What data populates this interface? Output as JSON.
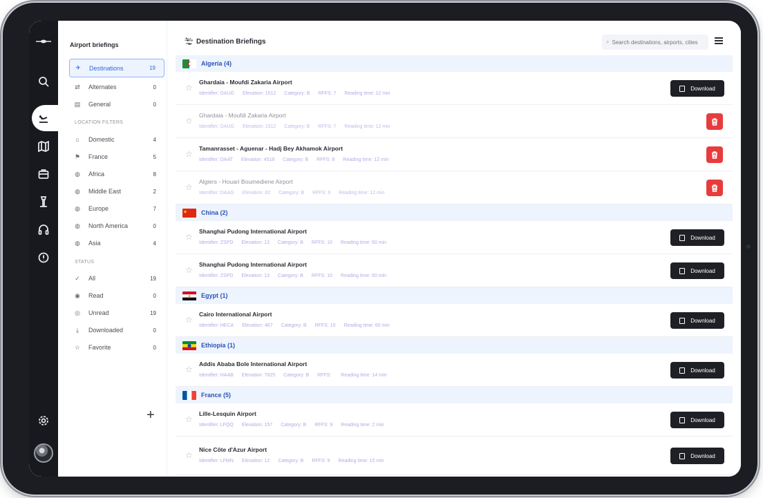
{
  "sidebar": {
    "title": "Airport briefings",
    "primary": [
      {
        "label": "Destinations",
        "count": "19",
        "icon": "plane-icon"
      },
      {
        "label": "Alternates",
        "count": "0",
        "icon": "swap-icon"
      },
      {
        "label": "General",
        "count": "0",
        "icon": "document-icon"
      }
    ],
    "location_section": "LOCATION FILTERS",
    "locations": [
      {
        "label": "Domestic",
        "count": "4",
        "icon": "home-icon"
      },
      {
        "label": "France",
        "count": "5",
        "icon": "flag-icon"
      },
      {
        "label": "Africa",
        "count": "8",
        "icon": "globe-icon"
      },
      {
        "label": "Middle East",
        "count": "2",
        "icon": "globe-icon"
      },
      {
        "label": "Europe",
        "count": "7",
        "icon": "globe-icon"
      },
      {
        "label": "North America",
        "count": "0",
        "icon": "globe-icon"
      },
      {
        "label": "Asia",
        "count": "4",
        "icon": "globe-icon"
      }
    ],
    "status_section": "STATUS",
    "status": [
      {
        "label": "All",
        "count": "19",
        "icon": "check-all-icon"
      },
      {
        "label": "Read",
        "count": "0",
        "icon": "eye-icon"
      },
      {
        "label": "Unread",
        "count": "19",
        "icon": "eye-off-icon"
      },
      {
        "label": "Downloaded",
        "count": "0",
        "icon": "download-icon"
      },
      {
        "label": "Favorite",
        "count": "0",
        "icon": "star-icon"
      }
    ],
    "add_label": "+"
  },
  "header": {
    "title": "Destination Briefings",
    "search_placeholder": "Search destinations, airports, cities"
  },
  "labels": {
    "download": "Download",
    "identifier": "Identifier:",
    "elevation": "Elevation:",
    "category": "Category:",
    "rffs": "RFFS:",
    "reading": "Reading time:"
  },
  "groups": [
    {
      "name": "Algeria (4)",
      "flag": "algeria"
    },
    {
      "name": "China (2)",
      "flag": "china"
    },
    {
      "name": "Egypt (1)",
      "flag": "egypt"
    },
    {
      "name": "Ethiopia (1)",
      "flag": "ethiopia"
    },
    {
      "name": "France (5)",
      "flag": "france"
    }
  ],
  "airports": [
    {
      "name": "Ghardaia - Moufdi Zakaria Airport",
      "id": "DAUG",
      "elev": "1512",
      "cat": "B",
      "rffs": "7",
      "time": "12 min",
      "action": "download",
      "muted": false
    },
    {
      "name": "Ghardaia - Moufdi Zakaria Airport",
      "id": "DAUG",
      "elev": "1512",
      "cat": "B",
      "rffs": "7",
      "time": "12 min",
      "action": "delete",
      "muted": true
    },
    {
      "name": "Tamanrasset - Aguenar - Hadj Bey Akhamok Airport",
      "id": "DAAT",
      "elev": "4518",
      "cat": "B",
      "rffs": "8",
      "time": "12 min",
      "action": "delete",
      "muted": false
    },
    {
      "name": "Algiers - Houari Boumediene Airport",
      "id": "DAAG",
      "elev": "82",
      "cat": "B",
      "rffs": "9",
      "time": "12 min",
      "action": "delete",
      "muted": true
    },
    {
      "name": "Shanghai Pudong International Airport",
      "id": "ZSPD",
      "elev": "13",
      "cat": "B",
      "rffs": "10",
      "time": "60 min",
      "action": "download",
      "muted": false
    },
    {
      "name": "Shanghai Pudong International Airport",
      "id": "ZSPD",
      "elev": "13",
      "cat": "B",
      "rffs": "10",
      "time": "60 min",
      "action": "download",
      "muted": false
    },
    {
      "name": "Cairo International Airport",
      "id": "HECA",
      "elev": "467",
      "cat": "B",
      "rffs": "10",
      "time": "60 min",
      "action": "download",
      "muted": false
    },
    {
      "name": "Addis Ababa Bole International Airport",
      "id": "HAAB",
      "elev": "7625",
      "cat": "B",
      "rffs": "",
      "time": "14 min",
      "action": "download",
      "muted": false
    },
    {
      "name": "Lille-Lesquin Airport",
      "id": "LFQQ",
      "elev": "157",
      "cat": "B",
      "rffs": "9",
      "time": "2 min",
      "action": "download",
      "muted": false
    },
    {
      "name": "Nice Côte d'Azur Airport",
      "id": "LFMN",
      "elev": "12",
      "cat": "B",
      "rffs": "9",
      "time": "15 min",
      "action": "download",
      "muted": false
    }
  ]
}
